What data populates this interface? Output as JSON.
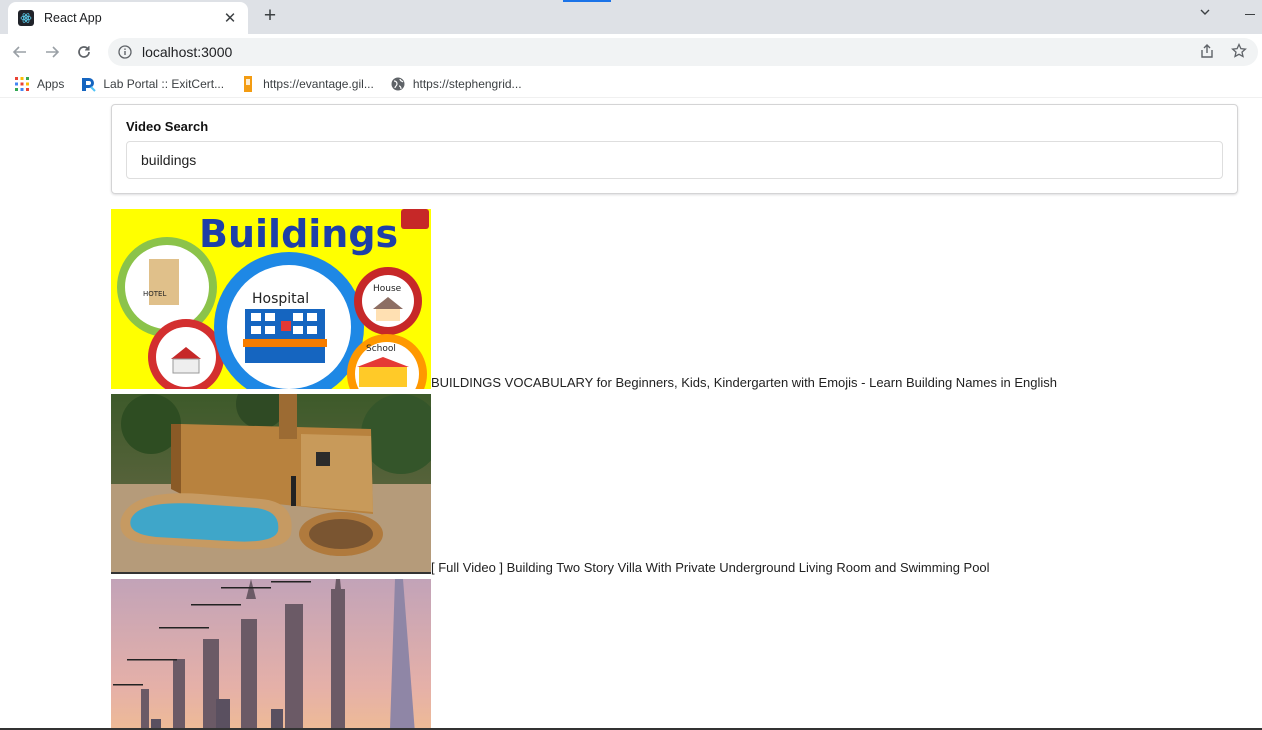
{
  "browser": {
    "tab_title": "React App",
    "url": "localhost:3000",
    "bookmarks": [
      {
        "label": "Apps",
        "icon": "apps-grid-icon"
      },
      {
        "label": "Lab Portal :: ExitCert...",
        "icon": "lab-portal-icon"
      },
      {
        "label": "https://evantage.gil...",
        "icon": "bookmark-orange-icon"
      },
      {
        "label": "https://stephengrid...",
        "icon": "globe-icon"
      }
    ]
  },
  "search": {
    "label": "Video Search",
    "value": "buildings"
  },
  "videos": [
    {
      "title": "BUILDINGS VOCABULARY for Beginners, Kids, Kindergarten with Emojis - Learn Building Names in English",
      "thumb_text": "Buildings",
      "thumb_labels": [
        "Hospital",
        "House",
        "School",
        "HOTEL"
      ]
    },
    {
      "title": "[ Full Video ] Building Two Story Villa With Private Underground Living Room and Swimming Pool"
    },
    {
      "title": ""
    }
  ],
  "colors": {
    "tabstrip": "#dee1e6",
    "accent": "#1a73e8",
    "thumb1_bg": "#ffff00"
  }
}
